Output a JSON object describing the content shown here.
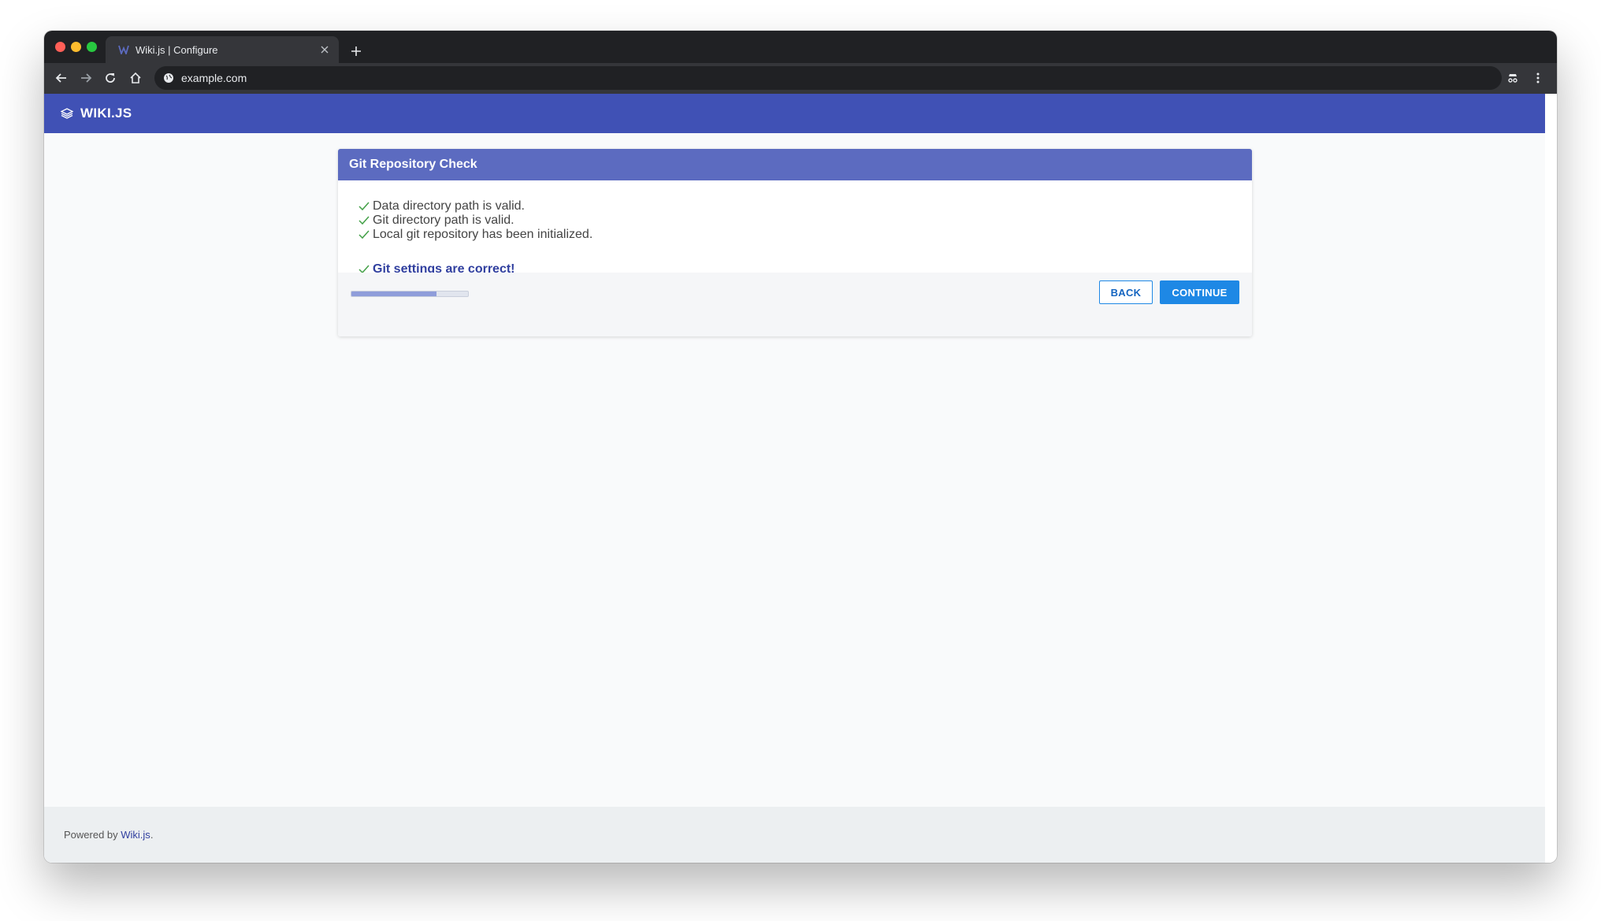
{
  "browser": {
    "tab_title": "Wiki.js | Configure",
    "url": "example.com"
  },
  "app": {
    "brand": "WIKI.JS"
  },
  "card": {
    "title": "Git Repository Check",
    "checks": [
      "Data directory path is valid.",
      "Git directory path is valid.",
      "Local git repository has been initialized."
    ],
    "success": "Git settings are correct!",
    "progress_fraction": 0.73,
    "back_label": "BACK",
    "continue_label": "CONTINUE"
  },
  "footer": {
    "prefix": "Powered by ",
    "link": "Wiki.js",
    "suffix": "."
  },
  "colors": {
    "appbar": "#4051b5",
    "card_header": "#5c6bc0",
    "check": "#43a047",
    "primary_button": "#1e88e5",
    "success_text": "#303f9f"
  },
  "icons": {
    "favicon": "wikijs-favicon",
    "brand": "layers-icon",
    "check": "checkmark-icon"
  }
}
